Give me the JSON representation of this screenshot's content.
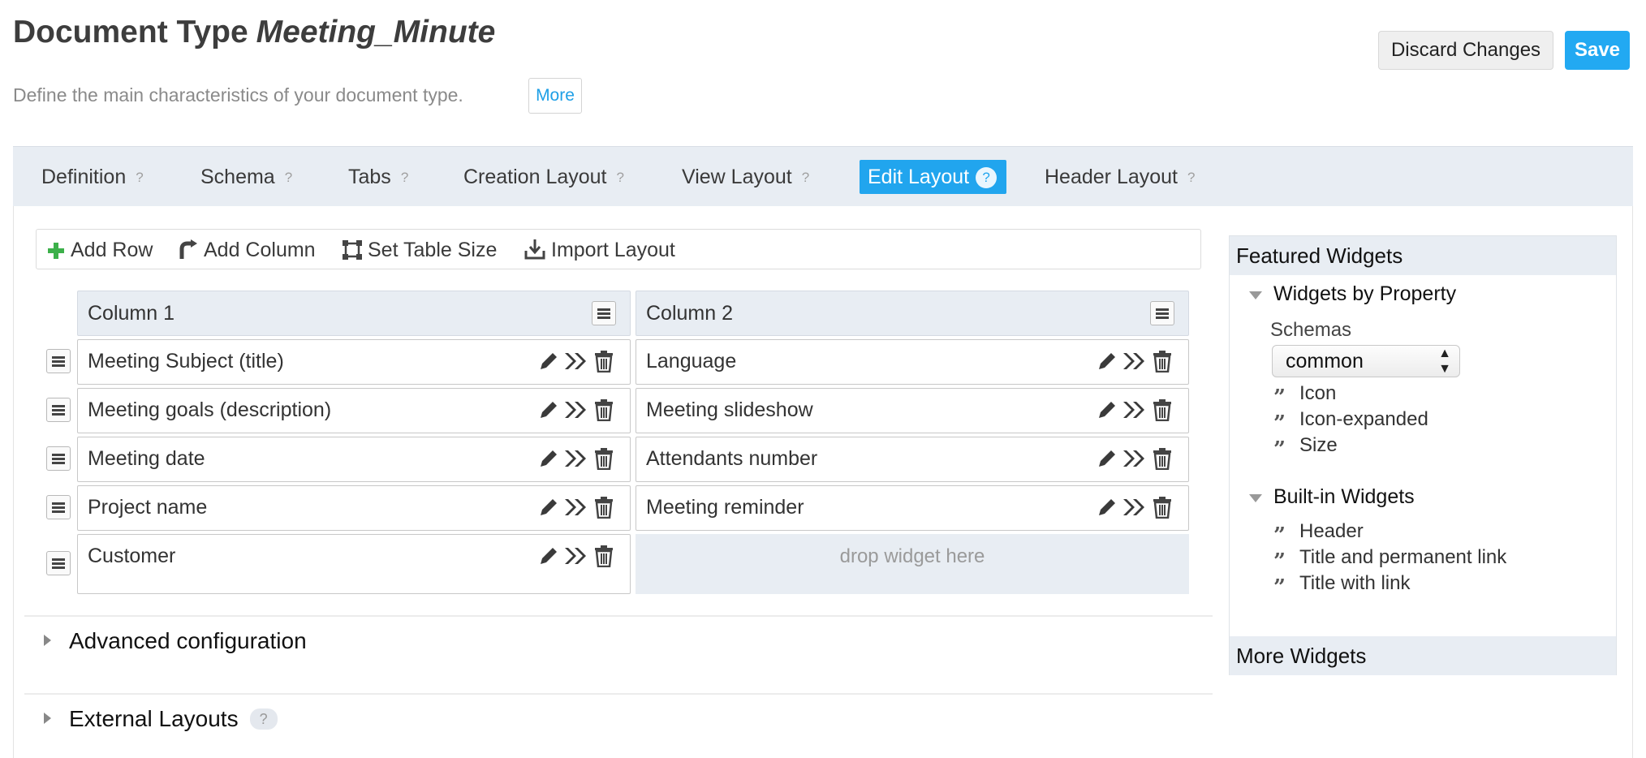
{
  "header": {
    "title_prefix": "Document Type",
    "doc_type_name": "Meeting_Minute",
    "subtitle": "Define the main characteristics of your document type.",
    "more_label": "More",
    "discard_label": "Discard Changes",
    "save_label": "Save"
  },
  "tabs": [
    {
      "label": "Definition",
      "help": "?"
    },
    {
      "label": "Schema",
      "help": "?"
    },
    {
      "label": "Tabs",
      "help": "?"
    },
    {
      "label": "Creation Layout",
      "help": "?"
    },
    {
      "label": "View Layout",
      "help": "?"
    },
    {
      "label": "Edit Layout",
      "help": "?",
      "active": true
    },
    {
      "label": "Header Layout",
      "help": "?"
    }
  ],
  "toolbar": {
    "add_row": "Add Row",
    "add_column": "Add Column",
    "set_table_size": "Set Table Size",
    "import_layout": "Import Layout"
  },
  "grid": {
    "columns": [
      "Column 1",
      "Column 2"
    ],
    "rows": [
      [
        "Meeting Subject (title)",
        "Language"
      ],
      [
        "Meeting goals (description)",
        "Meeting slideshow"
      ],
      [
        "Meeting date",
        "Attendants number"
      ],
      [
        "Project name",
        "Meeting reminder"
      ],
      [
        "Customer",
        ""
      ]
    ],
    "drop_placeholder": "drop widget here"
  },
  "sections": {
    "advanced": "Advanced configuration",
    "external": "External Layouts",
    "external_help": "?"
  },
  "sidebar": {
    "featured_title": "Featured Widgets",
    "by_property_title": "Widgets by Property",
    "schemas_label": "Schemas",
    "schema_selected": "common",
    "property_widgets": [
      "Icon",
      "Icon-expanded",
      "Size"
    ],
    "builtin_title": "Built-in Widgets",
    "builtin_widgets": [
      "Header",
      "Title and permanent link",
      "Title with link"
    ],
    "more_title": "More Widgets"
  },
  "colors": {
    "accent": "#21a5ee",
    "tab_bg": "#e8edf3",
    "add_green": "#3cb04a"
  }
}
